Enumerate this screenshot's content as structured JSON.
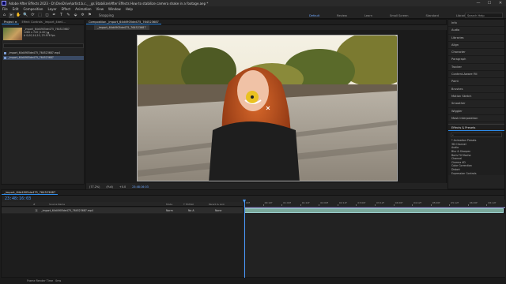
{
  "titlebar": {
    "title": "Adobe After Effects 2023 - D:\\OneDrive\\artist.b.c._ _gs Stabilize\\After Effects How to stabilize camera shake in a footage.aep *",
    "minimize": "—",
    "maximize": "☐",
    "close": "✕"
  },
  "menu": [
    "File",
    "Edit",
    "Composition",
    "Layer",
    "Effect",
    "Animation",
    "View",
    "Window",
    "Help"
  ],
  "toolbar": {
    "tools": [
      "⌂",
      "▸",
      "✋",
      "🔍",
      "⟳",
      "⬚",
      "◻",
      "✒",
      "T",
      "✎",
      "⬙",
      "✲",
      "⚑"
    ],
    "snapping": "Snapping",
    "workspaces": [
      "Default",
      "Review",
      "Learn",
      "Small Screen",
      "Standard",
      "Libraries"
    ],
    "active_workspace": "Default",
    "search_placeholder": "Search Help"
  },
  "project_panel": {
    "tabs": [
      "Project ≡",
      "Effect Controls _import_4de4..."
    ],
    "info_lines": [
      "_import_64d4905de475_764523687",
      "1280 x 720 (1.00) ▲",
      "Δ 0;00;14;10, 23.976 fps"
    ],
    "items": [
      "_import_64d4905de475_764523687.mp4",
      "_import_64d4905de475_764523687"
    ]
  },
  "composition": {
    "tab": "Composition _import_64d4905de475_764523687",
    "label": "_import_64d4905de475_764523687",
    "controls": {
      "zoom": "(77.2%)",
      "resolution": "(Full)",
      "timecode": "+0.0",
      "current_time": "23:48:16:03"
    }
  },
  "right_panel": {
    "items": [
      "Info",
      "Audio",
      "Libraries",
      "Align",
      "Character",
      "Paragraph",
      "Tracker",
      "Content-Aware Fill",
      "Paint",
      "Brushes",
      "Motion Sketch",
      "Smoother",
      "Wiggler",
      "Mask Interpolation"
    ],
    "effects_header": "Effects & Presets",
    "effects_search": "⌕",
    "effects": [
      "* Animation Presets",
      "3D Channel",
      "Audio",
      "Blur & Sharpen",
      "Boris FX Mocha",
      "Channel",
      "Cinema 4D",
      "Color Correction",
      "Distort",
      "Expression Controls"
    ]
  },
  "timeline": {
    "tab": "_import_64d4905de475_764523687",
    "timecode": "23:48:16:03",
    "columns": [
      "#",
      "Source Name",
      "Mode",
      "T  TrkMat",
      "Parent & Link"
    ],
    "layer": {
      "number": "1",
      "name": "_import_64d4905de475_764523687.mp4",
      "mode": "Norm",
      "trkmat": "No A",
      "parent": "None"
    },
    "ruler": [
      "00f",
      "00:12f",
      "01:00f",
      "01:12f",
      "02:00f",
      "02:12f",
      "03:00f",
      "03:12f",
      "04:00f",
      "04:12f",
      "05:00f",
      "05:12f",
      "06:00f",
      "06:12f"
    ]
  },
  "statusbar": {
    "render_time": "Frame Render Time",
    "render_value": "0ms"
  },
  "colors": {
    "accent": "#2d8ceb",
    "timecode": "#4a9bff",
    "layer_bar": "#7aa89a"
  }
}
